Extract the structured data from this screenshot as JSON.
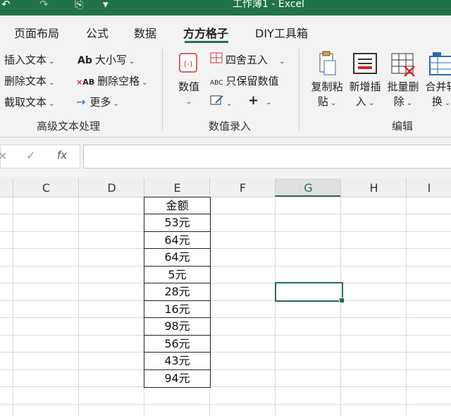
{
  "window": {
    "title": "工作薄1 - Excel"
  },
  "tabs": [
    {
      "label": "页面布局"
    },
    {
      "label": "公式"
    },
    {
      "label": "数据"
    },
    {
      "label": "方方格子",
      "active": true
    },
    {
      "label": "DIY工具箱"
    }
  ],
  "ribbon": {
    "text_group": {
      "label": "高级文本处理",
      "insert_text": "插入文本",
      "delete_text": "删除文本",
      "extract_text": "截取文本",
      "case": "大小写",
      "case_icon_text": "Ab",
      "delete_space": "删除空格",
      "delete_space_icon_text": "AB",
      "more": "更多"
    },
    "value_group": {
      "label": "数值录入",
      "value": "数值",
      "round": "四舍五入",
      "keep_value": "只保留数值",
      "keep_value_icon_text": "ABC"
    },
    "edit_group": {
      "label": "编辑",
      "copy_paste_1": "复制粘",
      "copy_paste_2": "贴",
      "insert_new_1": "新增插",
      "insert_new_2": "入",
      "batch_delete_1": "批量删",
      "batch_delete_2": "除",
      "merge_1": "合并转",
      "merge_2": "换"
    }
  },
  "formula_bar": {
    "fx": "fx",
    "value": ""
  },
  "columns": [
    "C",
    "D",
    "E",
    "F",
    "G",
    "H",
    "I"
  ],
  "selected_column": "G",
  "table": {
    "header": "金额",
    "values": [
      "53元",
      "64元",
      "64元",
      "5元",
      "28元",
      "16元",
      "98元",
      "56元",
      "43元",
      "94元"
    ]
  },
  "colors": {
    "accent": "#217346",
    "ribbon_bg": "#f3f3f3"
  }
}
